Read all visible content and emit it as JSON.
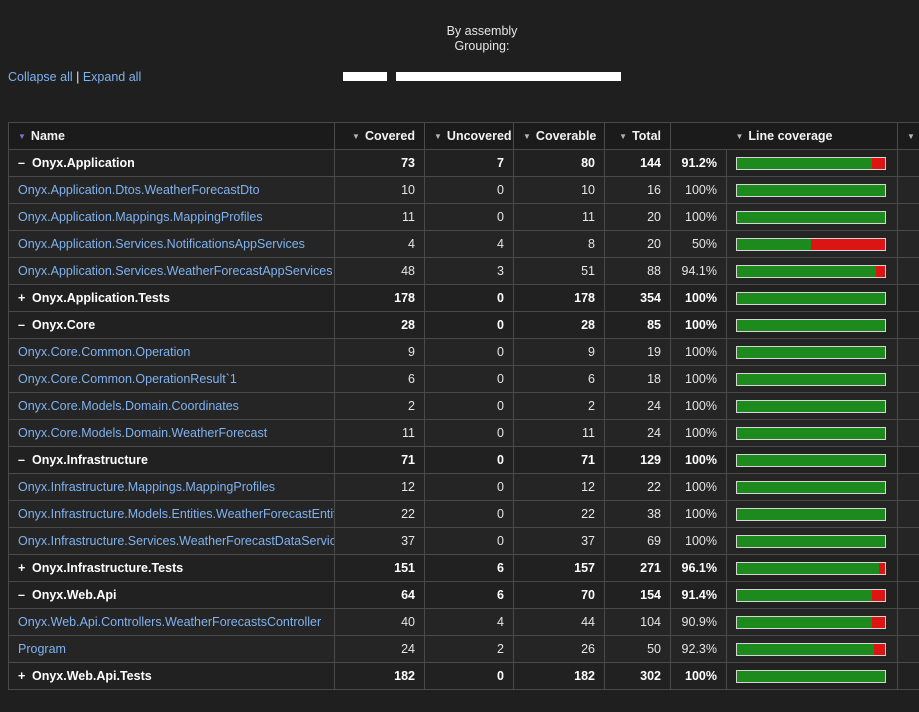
{
  "header": {
    "grouping_line1": "By assembly",
    "grouping_line2": "Grouping:"
  },
  "links": {
    "collapse_all": "Collapse all",
    "separator": "|",
    "expand_all": "Expand all"
  },
  "columns": {
    "name": "Name",
    "covered": "Covered",
    "uncovered": "Uncovered",
    "coverable": "Coverable",
    "total": "Total",
    "line_coverage": "Line coverage"
  },
  "colors": {
    "covered_bar": "#1c8a1c",
    "uncovered_bar": "#dd1414",
    "link": "#7fb2f0"
  },
  "rows": [
    {
      "kind": "group",
      "toggle": "–",
      "name": "Onyx.Application",
      "covered": "73",
      "uncovered": "7",
      "coverable": "80",
      "total": "144",
      "pct": "91.2%",
      "ratio": 0.912
    },
    {
      "kind": "class",
      "name": "Onyx.Application.Dtos.WeatherForecastDto",
      "covered": "10",
      "uncovered": "0",
      "coverable": "10",
      "total": "16",
      "pct": "100%",
      "ratio": 1
    },
    {
      "kind": "class",
      "name": "Onyx.Application.Mappings.MappingProfiles",
      "covered": "11",
      "uncovered": "0",
      "coverable": "11",
      "total": "20",
      "pct": "100%",
      "ratio": 1
    },
    {
      "kind": "class",
      "name": "Onyx.Application.Services.NotificationsAppServices",
      "covered": "4",
      "uncovered": "4",
      "coverable": "8",
      "total": "20",
      "pct": "50%",
      "ratio": 0.5
    },
    {
      "kind": "class",
      "name": "Onyx.Application.Services.WeatherForecastAppServices",
      "covered": "48",
      "uncovered": "3",
      "coverable": "51",
      "total": "88",
      "pct": "94.1%",
      "ratio": 0.941
    },
    {
      "kind": "group",
      "toggle": "+",
      "name": "Onyx.Application.Tests",
      "covered": "178",
      "uncovered": "0",
      "coverable": "178",
      "total": "354",
      "pct": "100%",
      "ratio": 1
    },
    {
      "kind": "group",
      "toggle": "–",
      "name": "Onyx.Core",
      "covered": "28",
      "uncovered": "0",
      "coverable": "28",
      "total": "85",
      "pct": "100%",
      "ratio": 1
    },
    {
      "kind": "class",
      "name": "Onyx.Core.Common.Operation",
      "covered": "9",
      "uncovered": "0",
      "coverable": "9",
      "total": "19",
      "pct": "100%",
      "ratio": 1
    },
    {
      "kind": "class",
      "name": "Onyx.Core.Common.OperationResult`1",
      "covered": "6",
      "uncovered": "0",
      "coverable": "6",
      "total": "18",
      "pct": "100%",
      "ratio": 1
    },
    {
      "kind": "class",
      "name": "Onyx.Core.Models.Domain.Coordinates",
      "covered": "2",
      "uncovered": "0",
      "coverable": "2",
      "total": "24",
      "pct": "100%",
      "ratio": 1
    },
    {
      "kind": "class",
      "name": "Onyx.Core.Models.Domain.WeatherForecast",
      "covered": "11",
      "uncovered": "0",
      "coverable": "11",
      "total": "24",
      "pct": "100%",
      "ratio": 1
    },
    {
      "kind": "group",
      "toggle": "–",
      "name": "Onyx.Infrastructure",
      "covered": "71",
      "uncovered": "0",
      "coverable": "71",
      "total": "129",
      "pct": "100%",
      "ratio": 1
    },
    {
      "kind": "class",
      "name": "Onyx.Infrastructure.Mappings.MappingProfiles",
      "covered": "12",
      "uncovered": "0",
      "coverable": "12",
      "total": "22",
      "pct": "100%",
      "ratio": 1
    },
    {
      "kind": "class",
      "name": "Onyx.Infrastructure.Models.Entities.WeatherForecastEntity",
      "covered": "22",
      "uncovered": "0",
      "coverable": "22",
      "total": "38",
      "pct": "100%",
      "ratio": 1
    },
    {
      "kind": "class",
      "name": "Onyx.Infrastructure.Services.WeatherForecastDataServices",
      "covered": "37",
      "uncovered": "0",
      "coverable": "37",
      "total": "69",
      "pct": "100%",
      "ratio": 1
    },
    {
      "kind": "group",
      "toggle": "+",
      "name": "Onyx.Infrastructure.Tests",
      "covered": "151",
      "uncovered": "6",
      "coverable": "157",
      "total": "271",
      "pct": "96.1%",
      "ratio": 0.961
    },
    {
      "kind": "group",
      "toggle": "–",
      "name": "Onyx.Web.Api",
      "covered": "64",
      "uncovered": "6",
      "coverable": "70",
      "total": "154",
      "pct": "91.4%",
      "ratio": 0.914
    },
    {
      "kind": "class",
      "name": "Onyx.Web.Api.Controllers.WeatherForecastsController",
      "covered": "40",
      "uncovered": "4",
      "coverable": "44",
      "total": "104",
      "pct": "90.9%",
      "ratio": 0.909
    },
    {
      "kind": "class",
      "name": "Program",
      "covered": "24",
      "uncovered": "2",
      "coverable": "26",
      "total": "50",
      "pct": "92.3%",
      "ratio": 0.923
    },
    {
      "kind": "group",
      "toggle": "+",
      "name": "Onyx.Web.Api.Tests",
      "covered": "182",
      "uncovered": "0",
      "coverable": "182",
      "total": "302",
      "pct": "100%",
      "ratio": 1
    }
  ]
}
